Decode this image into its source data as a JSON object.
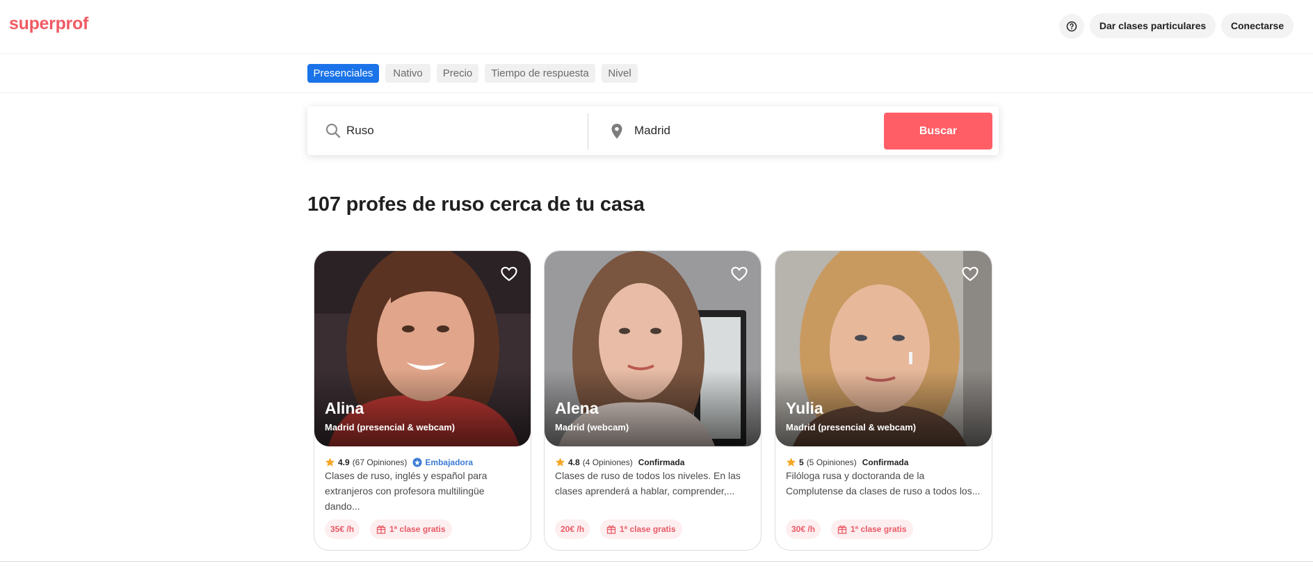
{
  "header": {
    "logo": "superprof",
    "give_classes_label": "Dar clases particulares",
    "connect_label": "Conectarse",
    "help_icon": "help-circle-icon"
  },
  "filters": [
    "Presenciales",
    "Nativo",
    "Precio",
    "Tiempo de respuesta",
    "Nivel"
  ],
  "active_filter": "Presenciales",
  "search": {
    "subject_value": "Ruso",
    "location_value": "Madrid",
    "button_label": "Buscar"
  },
  "results": {
    "title": "107 profes de ruso cerca de tu casa"
  },
  "teachers": [
    {
      "name": "Alina",
      "location": "Madrid (presencial & webcam)",
      "rating": "4.9",
      "reviews": "(67 Opiniones)",
      "badge": "Embajadora",
      "description": "Clases de ruso, inglés y español para extranjeros con profesora multilingüe dando...",
      "price": "35€ /h",
      "free_class": "1ª clase gratis"
    },
    {
      "name": "Alena",
      "location": "Madrid (webcam)",
      "rating": "4.8",
      "reviews": "(4 Opiniones)",
      "badge": "Confirmada",
      "description": "Clases de ruso de todos los niveles. En las clases aprenderá a hablar, comprender,...",
      "price": "20€ /h",
      "free_class": "1ª clase gratis"
    },
    {
      "name": "Yulia",
      "location": "Madrid (presencial & webcam)",
      "rating": "5",
      "reviews": "(5 Opiniones)",
      "badge": "Confirmada",
      "description": "Filóloga rusa y doctoranda de la Complutense da clases de ruso a todos los...",
      "price": "30€ /h",
      "free_class": "1ª clase gratis"
    }
  ],
  "colors": {
    "brand": "#ef5b63",
    "active_filter": "#1a73e8",
    "search_button": "#ff5e66",
    "ambassador": "#3a7bd5",
    "star": "#f5a623"
  }
}
